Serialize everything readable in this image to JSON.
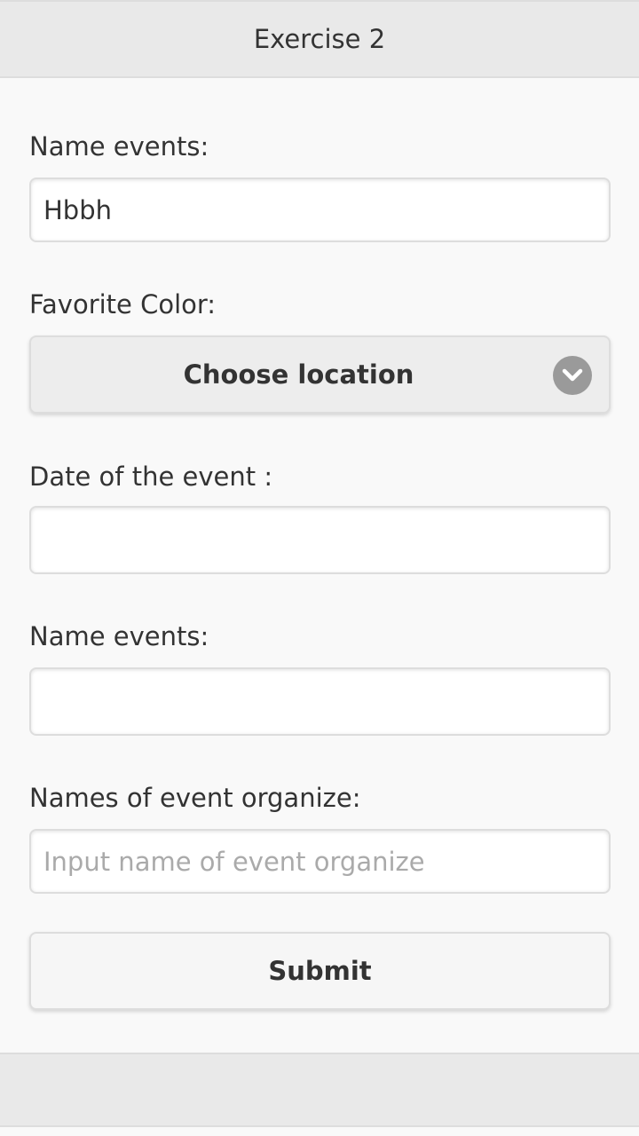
{
  "header": {
    "title": "Exercise 2"
  },
  "form": {
    "name_events_1": {
      "label": "Name events:",
      "value": "Hbbh",
      "placeholder": ""
    },
    "favorite_color": {
      "label": "Favorite Color:",
      "selected": "Choose location",
      "icon": "chevron-down-icon"
    },
    "event_date": {
      "label": "Date of the event :",
      "value": "",
      "placeholder": ""
    },
    "name_events_2": {
      "label": "Name events:",
      "value": "",
      "placeholder": ""
    },
    "organizer": {
      "label": "Names of event organize:",
      "value": "",
      "placeholder": "Input name of event organize"
    },
    "submit_label": "Submit"
  },
  "colors": {
    "header_bg": "#e9e9e9",
    "page_bg": "#f9f9f9",
    "chevron_bg": "#9a9a9a"
  }
}
